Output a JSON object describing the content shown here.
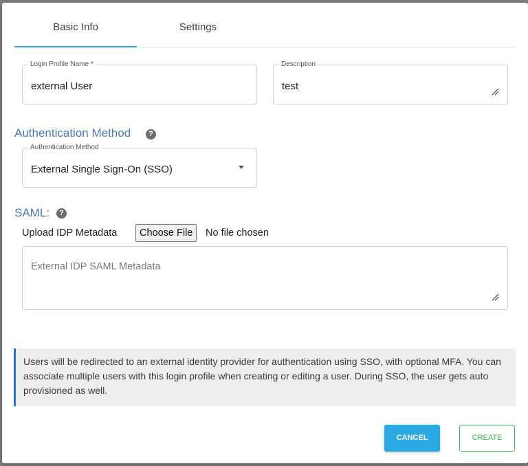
{
  "tabs": [
    {
      "label": "Basic Info",
      "active": true
    },
    {
      "label": "Settings",
      "active": false
    }
  ],
  "login_profile_name": {
    "label": "Login Profile Name *",
    "value": "external User"
  },
  "description": {
    "label": "Description",
    "value": "test"
  },
  "auth_section": {
    "title": "Authentication Method",
    "icon": "help-icon"
  },
  "auth_method": {
    "label": "Authentication Method",
    "value": "External Single Sign-On (SSO)"
  },
  "saml_section": {
    "title": "SAML:",
    "icon": "help-icon"
  },
  "upload": {
    "label": "Upload IDP Metadata",
    "button": "Choose File",
    "status": "No file chosen"
  },
  "saml_metadata": {
    "placeholder": "External IDP SAML Metadata"
  },
  "info": {
    "text": "Users will be redirected to an external identity provider for authentication using SSO, with optional MFA. You can associate multiple users with this login profile when creating or editing a user. During SSO, the user gets auto provisioned as well."
  },
  "buttons": {
    "cancel": "CANCEL",
    "create": "CREATE"
  },
  "colors": {
    "accent": "#2ea8e0",
    "section_title": "#4a78b8",
    "create": "#3cb55a",
    "info_border": "#2a72c4"
  }
}
